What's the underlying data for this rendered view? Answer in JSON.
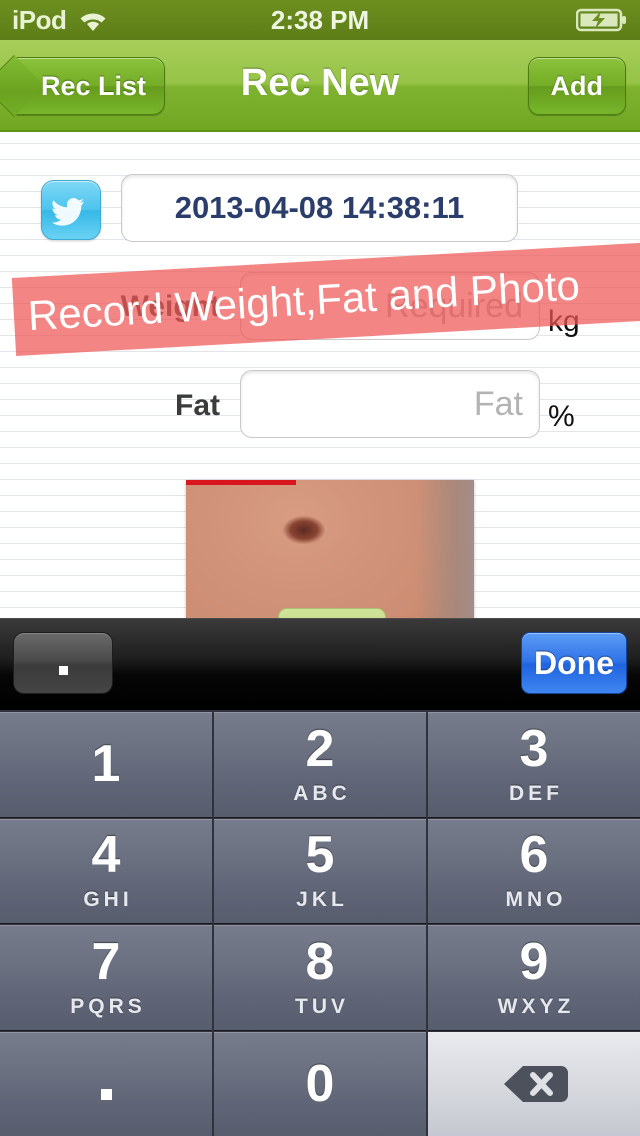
{
  "status_bar": {
    "carrier": "iPod",
    "wifi_icon": "wifi-icon",
    "time": "2:38 PM",
    "battery_icon": "battery-charging-icon"
  },
  "nav_bar": {
    "back_label": "Rec List",
    "title": "Rec New",
    "add_label": "Add",
    "background_color": "#8cc23c"
  },
  "form": {
    "twitter_icon": "twitter-bird-icon",
    "date_value": "2013-04-08 14:38:11",
    "weight": {
      "label": "Weight",
      "placeholder": "Required",
      "value": "",
      "unit": "kg"
    },
    "fat": {
      "label": "Fat",
      "placeholder": "Fat",
      "value": "",
      "unit": "%"
    },
    "photo": {
      "name": "body-photo-thumbnail"
    }
  },
  "banner": {
    "text": "Record Weight,Fat and Photo",
    "color": "#f05656"
  },
  "keyboard": {
    "toolbar": {
      "decimal_label": ".",
      "done_label": "Done",
      "done_color": "#2f72e8"
    },
    "keys": [
      {
        "digit": "1",
        "letters": ""
      },
      {
        "digit": "2",
        "letters": "ABC"
      },
      {
        "digit": "3",
        "letters": "DEF"
      },
      {
        "digit": "4",
        "letters": "GHI"
      },
      {
        "digit": "5",
        "letters": "JKL"
      },
      {
        "digit": "6",
        "letters": "MNO"
      },
      {
        "digit": "7",
        "letters": "PQRS"
      },
      {
        "digit": "8",
        "letters": "TUV"
      },
      {
        "digit": "9",
        "letters": "WXYZ"
      },
      {
        "digit": ".",
        "letters": ""
      },
      {
        "digit": "0",
        "letters": ""
      },
      {
        "digit": "",
        "letters": "",
        "icon": "backspace-icon"
      }
    ]
  }
}
